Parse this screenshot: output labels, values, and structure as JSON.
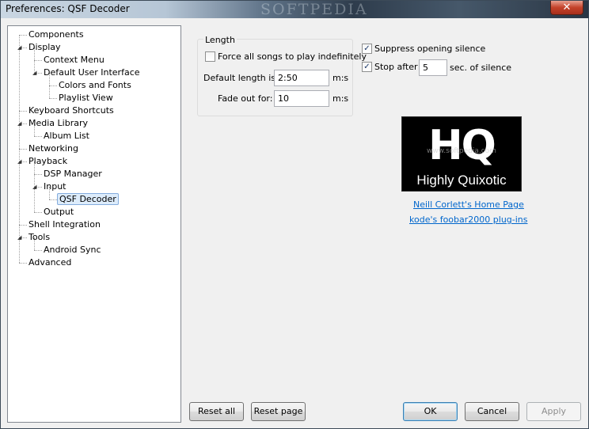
{
  "window": {
    "title": "Preferences: QSF Decoder",
    "close_label": "✕",
    "watermark": "SOFTPEDIA"
  },
  "tree": [
    {
      "label": "Components",
      "expander": ""
    },
    {
      "label": "Display",
      "expander": "◢"
    },
    {
      "label": "Context Menu",
      "expander": ""
    },
    {
      "label": "Default User Interface",
      "expander": "◢"
    },
    {
      "label": "Colors and Fonts",
      "expander": ""
    },
    {
      "label": "Playlist View",
      "expander": ""
    },
    {
      "label": "Keyboard Shortcuts",
      "expander": ""
    },
    {
      "label": "Media Library",
      "expander": "◢"
    },
    {
      "label": "Album List",
      "expander": ""
    },
    {
      "label": "Networking",
      "expander": ""
    },
    {
      "label": "Playback",
      "expander": "◢"
    },
    {
      "label": "DSP Manager",
      "expander": ""
    },
    {
      "label": "Input",
      "expander": "◢"
    },
    {
      "label": "QSF Decoder",
      "expander": ""
    },
    {
      "label": "Output",
      "expander": ""
    },
    {
      "label": "Shell Integration",
      "expander": ""
    },
    {
      "label": "Tools",
      "expander": "◢"
    },
    {
      "label": "Android Sync",
      "expander": ""
    },
    {
      "label": "Advanced",
      "expander": ""
    }
  ],
  "length_group": {
    "legend": "Length",
    "force_label": "Force all songs to play indefinitely",
    "force_check": "",
    "default_length_label": "Default length is:",
    "default_length_value": "2:50",
    "default_length_unit": "m:s",
    "fade_label": "Fade out for:",
    "fade_value": "10",
    "fade_unit": "m:s"
  },
  "silence": {
    "suppress_label": "Suppress opening silence",
    "suppress_check": "✓",
    "stop_label": "Stop after",
    "stop_check": "✓",
    "stop_value": "5",
    "stop_unit": "sec. of silence"
  },
  "logo": {
    "mark": "HQ",
    "text": "Highly Quixotic",
    "watermark": "www.softpedia.com"
  },
  "links": {
    "home": "Neill Corlett's Home Page",
    "plugins": "kode's foobar2000 plug-ins"
  },
  "buttons": {
    "reset_all": "Reset all",
    "reset_page": "Reset page",
    "ok": "OK",
    "cancel": "Cancel",
    "apply": "Apply"
  }
}
